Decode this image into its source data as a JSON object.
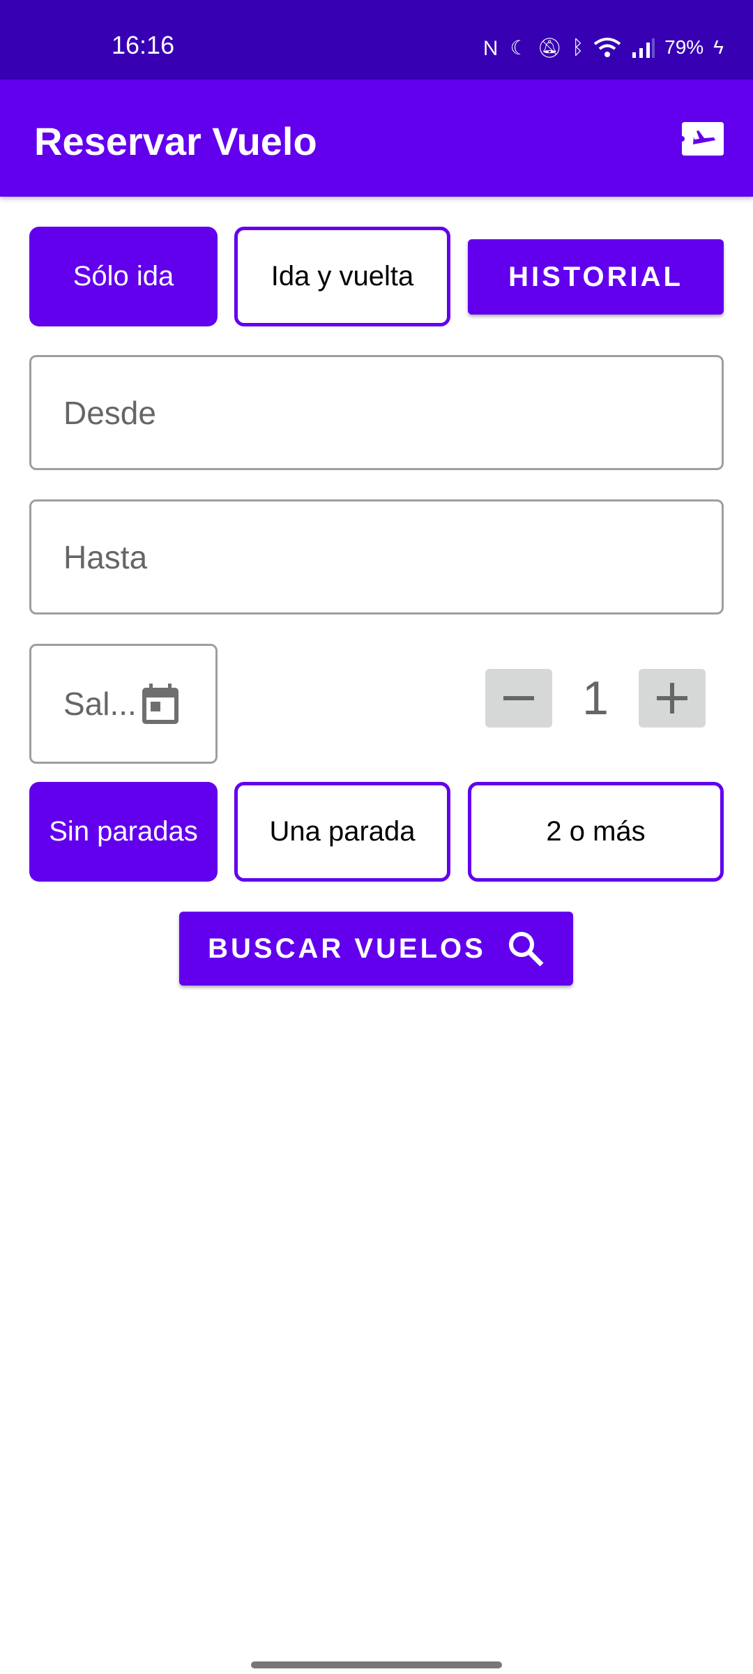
{
  "status_bar": {
    "time": "16:16",
    "battery": "79%",
    "icons": [
      "nfc-icon",
      "dnd-moon-icon",
      "bell-off-icon",
      "bluetooth-icon",
      "wifi-icon",
      "signal-icon",
      "charging-icon"
    ]
  },
  "toolbar": {
    "title": "Reservar Vuelo",
    "action_icon": "flight-ticket-icon"
  },
  "trip_type": {
    "one_way": "Sólo ida",
    "round_trip": "Ida y vuelta",
    "selected": "Sólo ida"
  },
  "history_button": "HISTORIAL",
  "from_field": {
    "placeholder": "Desde",
    "value": ""
  },
  "to_field": {
    "placeholder": "Hasta",
    "value": ""
  },
  "departure_field": {
    "placeholder": "Sal...",
    "icon": "calendar-icon"
  },
  "passengers": {
    "count": "1"
  },
  "stops": {
    "none": "Sin paradas",
    "one": "Una parada",
    "two_plus": "2 o más",
    "selected": "Sin paradas"
  },
  "search_button": "BUSCAR VUELOS",
  "colors": {
    "primary": "#6200EE",
    "primary_dark": "#3700B3"
  }
}
